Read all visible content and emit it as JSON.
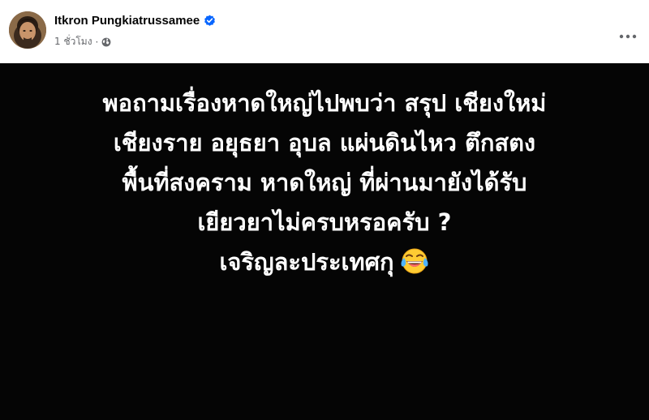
{
  "post": {
    "author_name": "Itkron Pungkiatrussamee",
    "timestamp": "1 ชั่วโมง",
    "separator": "·",
    "audience_icon": "globe-icon",
    "verified_icon": "verified-badge-icon",
    "more_icon": "ellipsis-icon"
  },
  "content": {
    "background_color": "#050505",
    "text_color": "#ffffff",
    "lines": [
      "พอถามเรื่องหาดใหญ่ไปพบว่า สรุป เชียงใหม่",
      "เชียงราย อยุธยา อุบล แผ่นดินไหว ตึกสตง",
      "พื้นที่สงคราม หาดใหญ่ ที่ผ่านมายังได้รับ",
      "เยียวยาไม่ครบหรอครับ ?",
      "เจริญละประเทศกุ"
    ],
    "emoji": "face-with-tears-of-joy-icon"
  },
  "colors": {
    "verified_blue": "#0866ff",
    "meta_gray": "#65676b",
    "name_black": "#050505"
  }
}
